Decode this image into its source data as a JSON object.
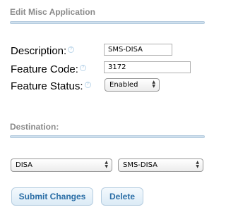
{
  "header": {
    "title": "Edit Misc Application"
  },
  "form": {
    "description": {
      "label": "Description:",
      "value": "SMS-DISA"
    },
    "feature_code": {
      "label": "Feature Code:",
      "value": "3172"
    },
    "feature_status": {
      "label": "Feature Status:",
      "value": "Enabled"
    }
  },
  "destination": {
    "title": "Destination:",
    "type_select": {
      "value": "DISA"
    },
    "target_select": {
      "value": "SMS-DISA"
    }
  },
  "actions": {
    "submit_label": "Submit Changes",
    "delete_label": "Delete"
  },
  "icons": {
    "help": "help-icon",
    "select_arrows": "up-down-arrows-icon"
  },
  "colors": {
    "section_title": "#8a8a8a",
    "divider": "#cfe0ee",
    "button_text": "#2b6ea6",
    "button_bg": "#e6f0f8"
  }
}
